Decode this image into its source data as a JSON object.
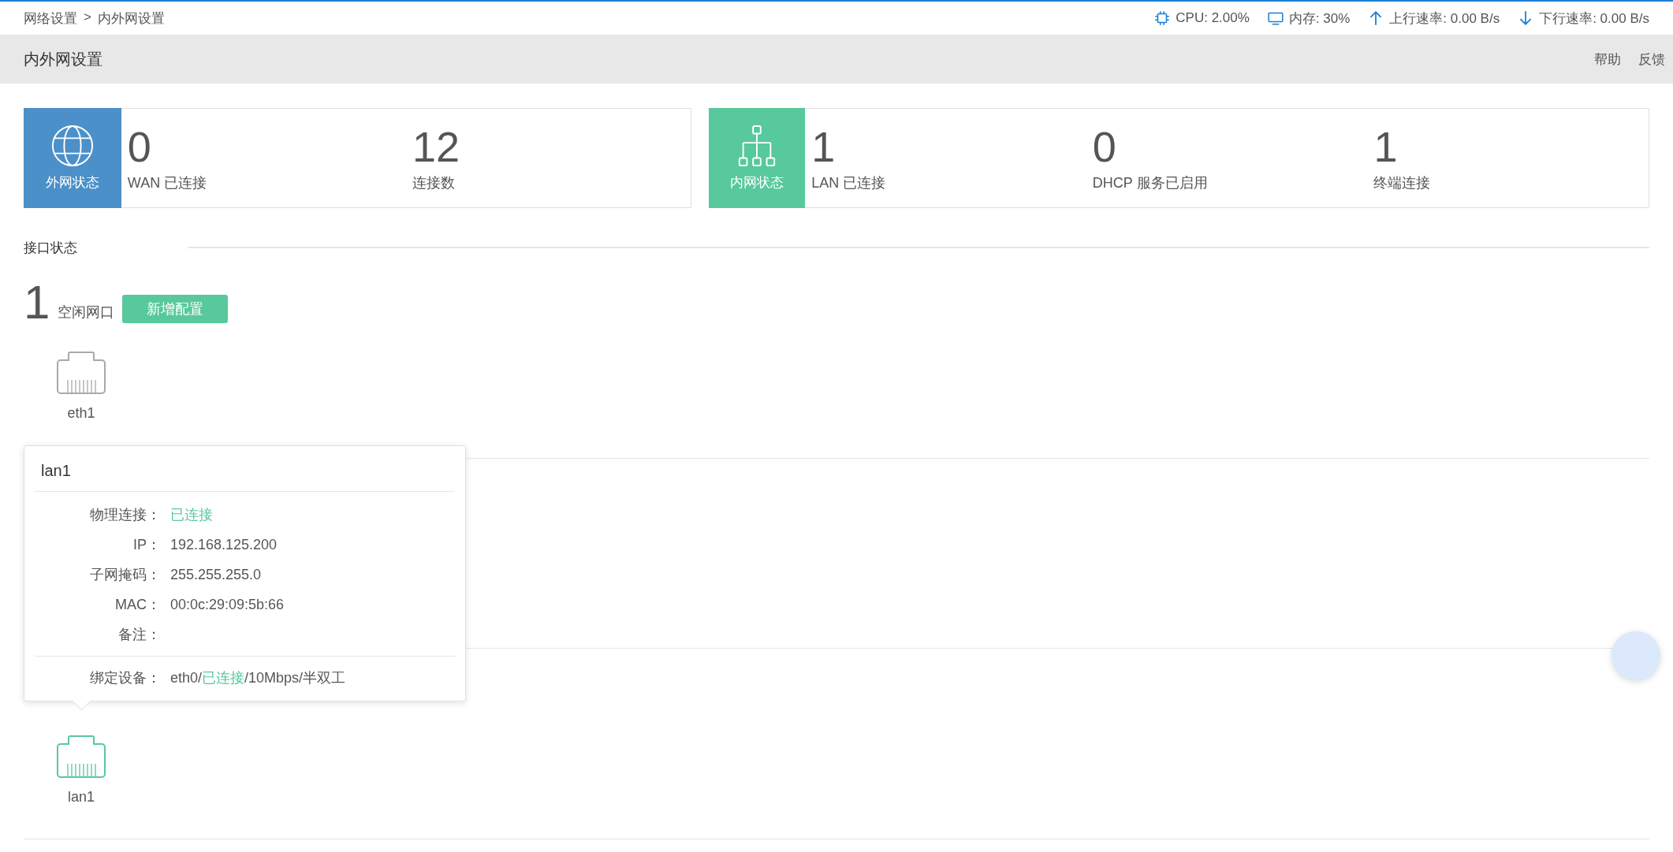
{
  "breadcrumb": {
    "items": [
      "网络设置",
      "内外网设置"
    ],
    "separator": ">"
  },
  "system_stats": [
    {
      "kind": "cpu",
      "text": "CPU: 2.00%"
    },
    {
      "kind": "memory",
      "text": "内存: 30%"
    },
    {
      "kind": "upload",
      "text": "上行速率: 0.00 B/s"
    },
    {
      "kind": "download",
      "text": "下行速率: 0.00 B/s"
    }
  ],
  "header": {
    "title": "内外网设置",
    "links": [
      "帮助",
      "反馈"
    ]
  },
  "status_cards": [
    {
      "kind": "wan",
      "title": "外网状态",
      "metrics": [
        {
          "value": "0",
          "label": "WAN 已连接"
        },
        {
          "value": "12",
          "label": "连接数"
        }
      ]
    },
    {
      "kind": "lan",
      "title": "内网状态",
      "metrics": [
        {
          "value": "1",
          "label": "LAN 已连接"
        },
        {
          "value": "0",
          "label": "DHCP 服务已启用"
        },
        {
          "value": "1",
          "label": "终端连接"
        }
      ]
    }
  ],
  "interface_status": {
    "title": "接口状态",
    "idle_count": "1",
    "idle_label": "空闲网口",
    "add_button": "新增配置",
    "idle_ports": [
      {
        "name": "eth1",
        "connected": false
      }
    ],
    "bound_ports": [
      {
        "name": "lan1",
        "connected": true
      }
    ]
  },
  "tooltip": {
    "title": "lan1",
    "rows": [
      {
        "label": "物理连接：",
        "parts": [
          {
            "text": "已连接",
            "highlight": true
          }
        ]
      },
      {
        "label": "IP：",
        "parts": [
          {
            "text": "192.168.125.200",
            "highlight": false
          }
        ]
      },
      {
        "label": "子网掩码：",
        "parts": [
          {
            "text": "255.255.255.0",
            "highlight": false
          }
        ]
      },
      {
        "label": "MAC：",
        "parts": [
          {
            "text": "00:0c:29:09:5b:66",
            "highlight": false
          }
        ]
      },
      {
        "label": "备注：",
        "parts": []
      }
    ],
    "footer": {
      "label": "绑定设备：",
      "parts": [
        {
          "text": "eth0/",
          "highlight": false
        },
        {
          "text": "已连接",
          "highlight": true
        },
        {
          "text": "/10Mbps/半双工",
          "highlight": false
        }
      ]
    }
  }
}
